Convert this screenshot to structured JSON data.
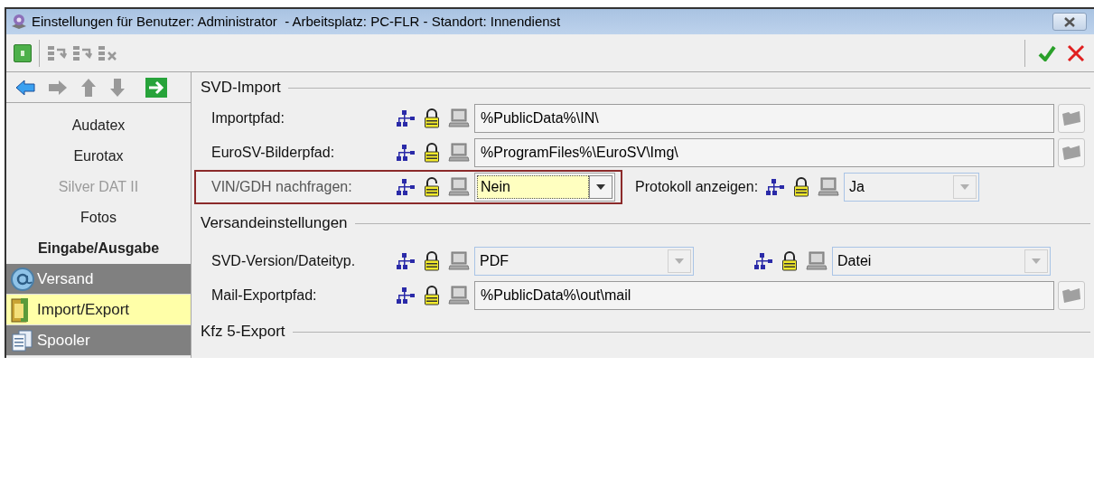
{
  "window": {
    "title": "Einstellungen für Benutzer: Administrator  - Arbeitsplatz: PC-FLR - Standort: Innendienst"
  },
  "sidebar": {
    "items": [
      {
        "label": "Audatex",
        "kind": "link",
        "disabled": false,
        "selected": false
      },
      {
        "label": "Eurotax",
        "kind": "link",
        "disabled": false,
        "selected": false
      },
      {
        "label": "Silver DAT II",
        "kind": "link",
        "disabled": true,
        "selected": false
      },
      {
        "label": "Fotos",
        "kind": "link",
        "disabled": false,
        "selected": false
      },
      {
        "label": "Eingabe/Ausgabe",
        "kind": "header",
        "disabled": false,
        "selected": false
      },
      {
        "label": "Versand",
        "kind": "module",
        "disabled": false,
        "selected": false
      },
      {
        "label": "Import/Export",
        "kind": "module",
        "disabled": false,
        "selected": true
      },
      {
        "label": "Spooler",
        "kind": "module",
        "disabled": false,
        "selected": false
      }
    ]
  },
  "sections": [
    {
      "title": "SVD-Import",
      "rows": [
        {
          "highlighted": false,
          "fields": [
            {
              "label": "Importpfad:",
              "kind": "path",
              "locked": true,
              "value": "%PublicData%\\IN\\"
            }
          ]
        },
        {
          "highlighted": false,
          "fields": [
            {
              "label": "EuroSV-Bilderpfad:",
              "kind": "path",
              "locked": true,
              "value": "%ProgramFiles%\\EuroSV\\Img\\"
            }
          ]
        },
        {
          "highlighted": true,
          "fields": [
            {
              "label": "VIN/GDH nachfragen:",
              "kind": "combo",
              "locked": false,
              "focused": true,
              "value": "Nein"
            },
            {
              "label": "Protokoll anzeigen:",
              "kind": "combo",
              "locked": true,
              "focused": false,
              "value": "Ja"
            }
          ]
        }
      ]
    },
    {
      "title": "Versandeinstellungen",
      "rows": [
        {
          "highlighted": false,
          "fields": [
            {
              "label": "SVD-Version/Dateityp.",
              "kind": "combo",
              "locked": true,
              "focused": false,
              "value": "PDF"
            },
            {
              "kind": "combo",
              "locked": true,
              "focused": false,
              "value": "Datei"
            }
          ]
        },
        {
          "highlighted": false,
          "fields": [
            {
              "label": "Mail-Exportpfad:",
              "kind": "path",
              "locked": true,
              "value": "%PublicData%\\out\\mail"
            }
          ]
        }
      ]
    },
    {
      "title": "Kfz 5-Export"
    }
  ]
}
